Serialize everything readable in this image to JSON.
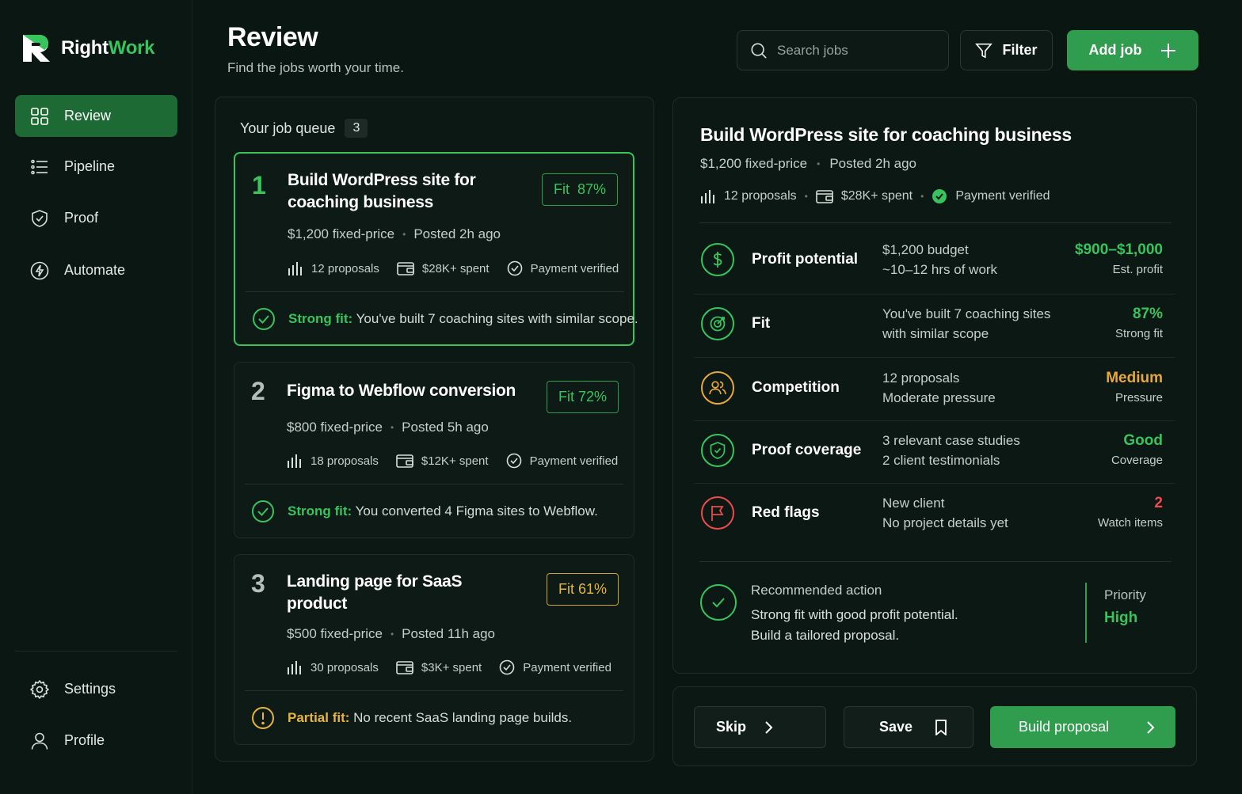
{
  "brand": {
    "name_part1": "Right",
    "name_part2": "Work",
    "accent": "#37c45d"
  },
  "sidebar": {
    "items": [
      {
        "label": "Review",
        "icon": "grid-icon",
        "active": true
      },
      {
        "label": "Pipeline",
        "icon": "list-icon"
      },
      {
        "label": "Proof",
        "icon": "shield-icon"
      },
      {
        "label": "Automate",
        "icon": "bolt-icon"
      }
    ],
    "bottom_items": [
      {
        "label": "Settings",
        "icon": "gear-icon"
      },
      {
        "label": "Profile",
        "icon": "user-icon"
      }
    ]
  },
  "header": {
    "title": "Review",
    "subtitle": "Find the jobs worth your time.",
    "search_placeholder": "Search jobs",
    "filter_label": "Filter",
    "add_label": "Add job"
  },
  "queue": {
    "label": "Your job queue",
    "count": "3",
    "jobs": [
      {
        "num": "1",
        "title": "Build WordPress site for coaching business",
        "fit": "Fit  87%",
        "price": "$1,200 fixed-price",
        "posted": "Posted 2h ago",
        "proposals": "12 proposals",
        "spent": "$28K+ spent",
        "payment": "Payment verified",
        "fit_key": "Strong fit:",
        "fit_text": "You've built 7 coaching sites with similar scope."
      },
      {
        "num": "2",
        "title": "Figma to Webflow conversion",
        "fit": "Fit  72%",
        "price": "$800 fixed-price",
        "posted": "Posted 5h ago",
        "proposals": "18 proposals",
        "spent": "$12K+ spent",
        "payment": "Payment verified",
        "fit_key": "Strong fit:",
        "fit_text": "You converted 4 Figma sites to Webflow."
      },
      {
        "num": "3",
        "title": "Landing page for SaaS product",
        "fit": "Fit  61%",
        "price": "$500 fixed-price",
        "posted": "Posted 11h ago",
        "proposals": "30 proposals",
        "spent": "$3K+ spent",
        "payment": "Payment verified",
        "fit_key": "Partial fit:",
        "fit_text": "No recent SaaS landing page builds."
      }
    ]
  },
  "detail": {
    "title": "Build WordPress site for coaching business",
    "price": "$1,200 fixed-price",
    "posted": "Posted 2h ago",
    "proposals": "12 proposals",
    "spent": "$28K+ spent",
    "payment": "Payment verified",
    "metrics": [
      {
        "label": "Profit potential",
        "desc1": "$1,200 budget",
        "desc2": "~10–12 hrs of work",
        "value": "$900–$1,000",
        "sub": "Est. profit",
        "color": "#37c45d",
        "icon": "dollar-icon"
      },
      {
        "label": "Fit",
        "desc1": "You've built 7 coaching sites",
        "desc2": "with similar scope",
        "value": "87%",
        "sub": "Strong fit",
        "color": "#37c45d",
        "icon": "target-icon"
      },
      {
        "label": "Competition",
        "desc1": "12 proposals",
        "desc2": "Moderate pressure",
        "value": "Medium",
        "sub": "Pressure",
        "color": "#e8a83a",
        "icon": "users-icon"
      },
      {
        "label": "Proof coverage",
        "desc1": "3 relevant case studies",
        "desc2": "2 client testimonials",
        "value": "Good",
        "sub": "Coverage",
        "color": "#37c45d",
        "icon": "shield-check-icon"
      },
      {
        "label": "Red flags",
        "desc1": "New client",
        "desc2": "No project details yet",
        "value": "2",
        "sub": "Watch items",
        "color": "#ef4b4b",
        "icon": "flag-icon"
      }
    ],
    "recommendation": {
      "title": "Recommended action",
      "line1": "Strong fit with good profit potential.",
      "line2": "Build a tailored proposal.",
      "priority_label": "Priority",
      "priority_value": "High"
    }
  },
  "actions": {
    "skip": "Skip",
    "save": "Save",
    "build": "Build proposal"
  }
}
